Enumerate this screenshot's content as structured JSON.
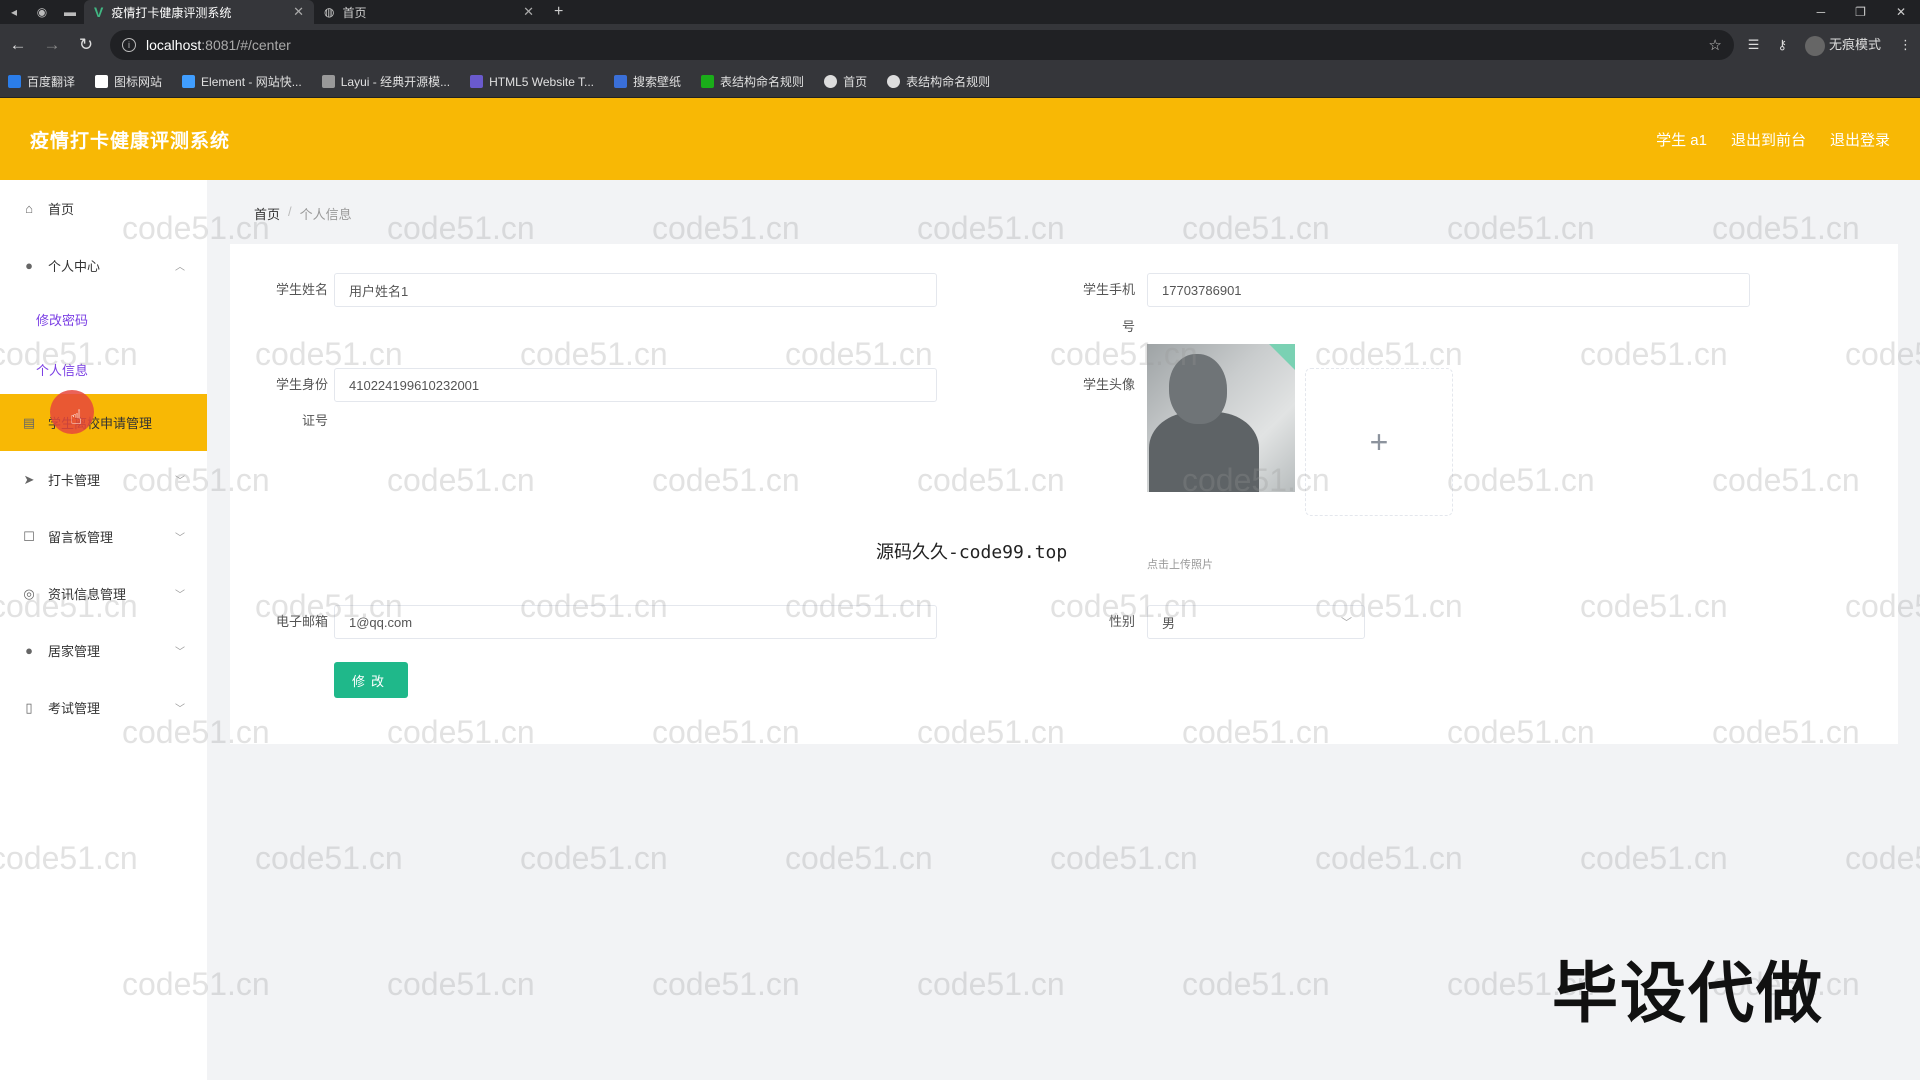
{
  "browser": {
    "tabs": [
      {
        "title": "疫情打卡健康评测系统",
        "active": true
      },
      {
        "title": "首页",
        "active": false
      }
    ],
    "url_host": "localhost",
    "url_path": ":8081/#/center",
    "profile_label": "无痕模式",
    "bookmarks": [
      "百度翻译",
      "图标网站",
      "Element - 网站快...",
      "Layui - 经典开源模...",
      "HTML5 Website T...",
      "搜索壁纸",
      "表结构命名规则",
      "首页",
      "表结构命名规则"
    ]
  },
  "header": {
    "title": "疫情打卡健康评测系统",
    "user": "学生 a1",
    "back_to_front": "退出到前台",
    "logout": "退出登录"
  },
  "sidebar": {
    "items": [
      {
        "label": "首页",
        "icon": "home-icon"
      },
      {
        "label": "个人中心",
        "icon": "user-icon",
        "sub": [
          "修改密码",
          "个人信息"
        ]
      },
      {
        "label": "学生离校申请管理",
        "icon": "file-icon",
        "active": true
      },
      {
        "label": "打卡管理",
        "icon": "send-icon"
      },
      {
        "label": "留言板管理",
        "icon": "message-icon"
      },
      {
        "label": "资讯信息管理",
        "icon": "info-icon"
      },
      {
        "label": "居家管理",
        "icon": "user-icon"
      },
      {
        "label": "考试管理",
        "icon": "exam-icon"
      }
    ]
  },
  "breadcrumb": {
    "home": "首页",
    "current": "个人信息"
  },
  "form": {
    "name_label": "学生姓名",
    "name_value": "用户姓名1",
    "phone_label_1": "学生手机",
    "phone_label_2": "号",
    "phone_value": "17703786901",
    "id_label_1": "学生身份",
    "id_label_2": "证号",
    "id_value": "410224199610232001",
    "avatar_label": "学生头像",
    "upload_tip": "点击上传照片",
    "email_label": "电子邮箱",
    "email_value": "1@qq.com",
    "gender_label": "性别",
    "gender_value": "男",
    "submit": "修改"
  },
  "overlay": {
    "watermark": "code51.cn",
    "caption": "源码久久-code99.top",
    "promo": "毕设代做"
  }
}
